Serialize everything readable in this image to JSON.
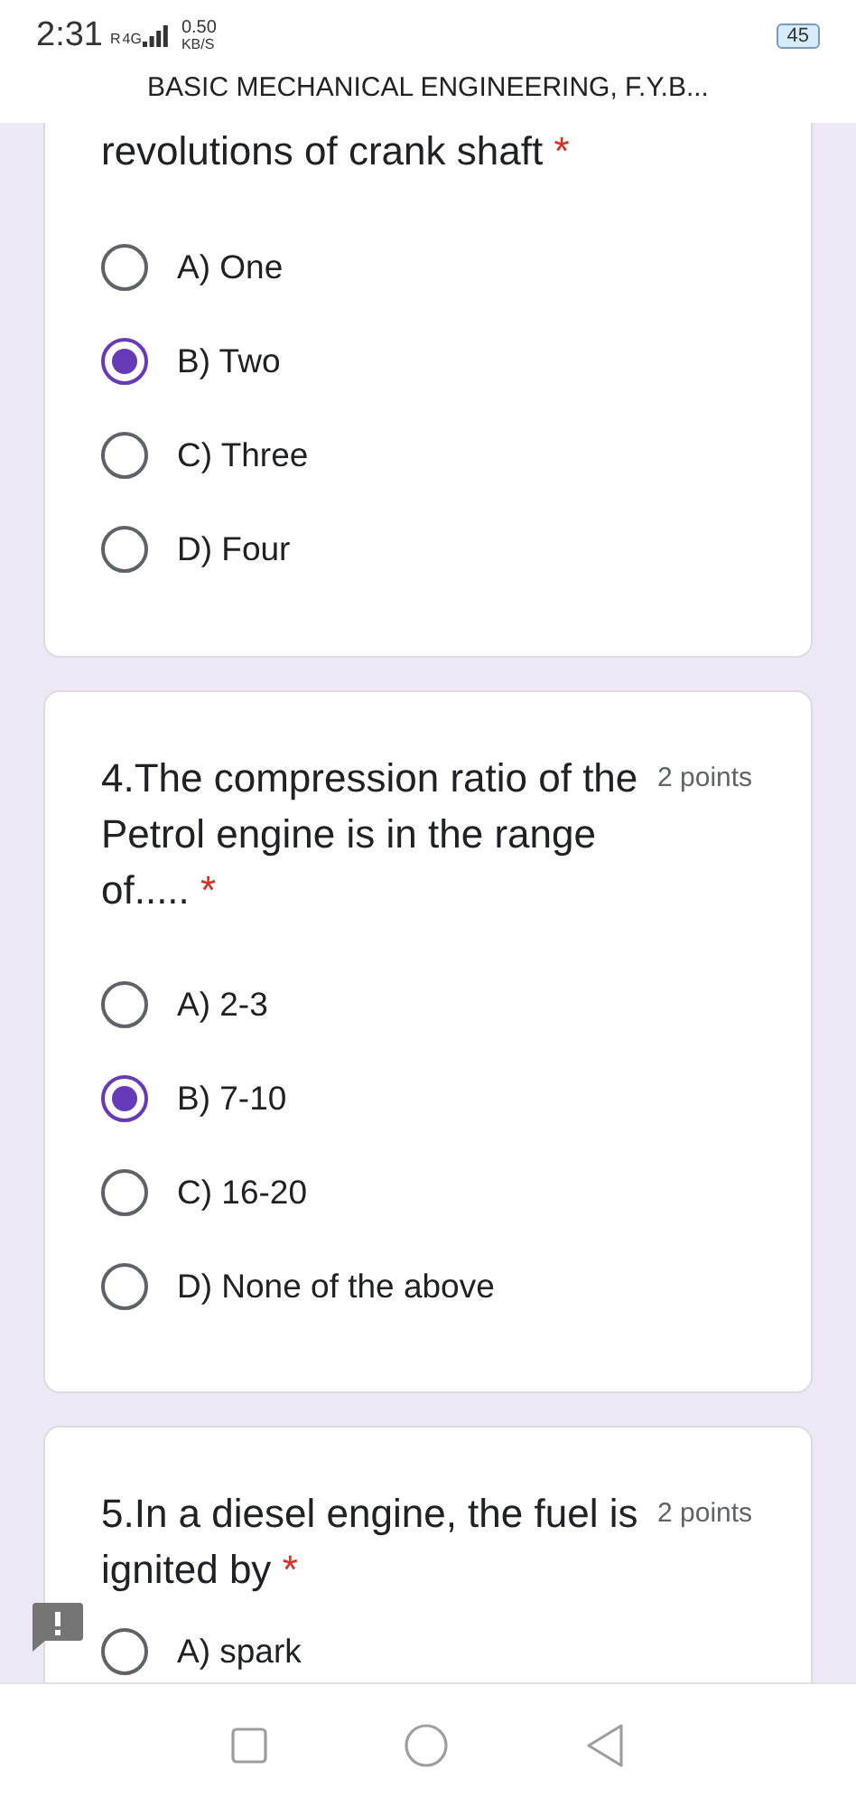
{
  "status_bar": {
    "time": "2:31",
    "roaming": "R",
    "network": "4G",
    "data_speed": "0.50",
    "data_unit": "KB/S",
    "battery": "45"
  },
  "title": "BASIC MECHANICAL ENGINEERING, F.Y.B...",
  "questions": [
    {
      "text": "revolutions of crank shaft",
      "required_mark": "*",
      "options": [
        {
          "label": "A) One",
          "selected": false
        },
        {
          "label": "B) Two",
          "selected": true
        },
        {
          "label": "C) Three",
          "selected": false
        },
        {
          "label": "D) Four",
          "selected": false
        }
      ]
    },
    {
      "text": "4.The compression ratio of the Petrol engine is in the range of.....",
      "points": "2 points",
      "required_mark": "*",
      "options": [
        {
          "label": "A) 2-3",
          "selected": false
        },
        {
          "label": "B) 7-10",
          "selected": true
        },
        {
          "label": "C) 16-20",
          "selected": false
        },
        {
          "label": "D) None of the above",
          "selected": false
        }
      ]
    },
    {
      "text": "5.In a diesel engine, the fuel is ignited by",
      "points": "2 points",
      "required_mark": "*",
      "options": [
        {
          "label": "A) spark",
          "selected": false
        }
      ]
    }
  ]
}
